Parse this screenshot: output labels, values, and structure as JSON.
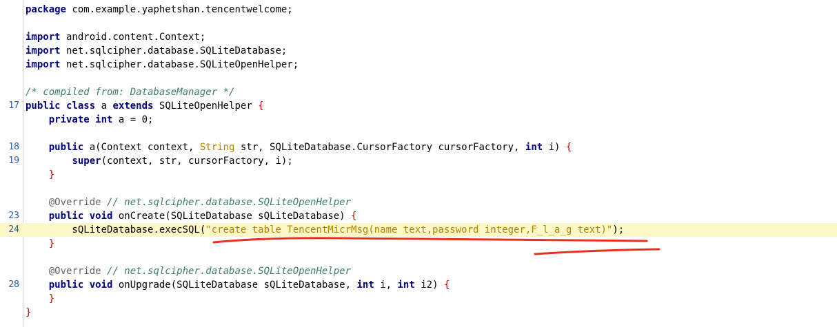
{
  "editor": {
    "colors": {
      "keyword": "#000080",
      "comment": "#3f7f5f",
      "string": "#b58200",
      "brace": "#c80000",
      "highlight": "#fcf8c8",
      "line_number": "#2d5aa8",
      "annotation_mark": "#e8321e"
    },
    "lines": [
      {
        "num": "",
        "tokens": [
          {
            "t": "package",
            "c": "kw"
          },
          {
            "t": " com.example.yaphetshan.tencentwelcome;",
            "c": ""
          }
        ]
      },
      {
        "num": "",
        "tokens": []
      },
      {
        "num": "",
        "tokens": [
          {
            "t": "import",
            "c": "kw"
          },
          {
            "t": " android.content.Context;",
            "c": ""
          }
        ]
      },
      {
        "num": "",
        "tokens": [
          {
            "t": "import",
            "c": "kw"
          },
          {
            "t": " net.sqlcipher.database.SQLiteDatabase;",
            "c": ""
          }
        ]
      },
      {
        "num": "",
        "tokens": [
          {
            "t": "import",
            "c": "kw"
          },
          {
            "t": " net.sqlcipher.database.SQLiteOpenHelper;",
            "c": ""
          }
        ]
      },
      {
        "num": "",
        "tokens": []
      },
      {
        "num": "",
        "tokens": [
          {
            "t": "/* compiled from: DatabaseManager */",
            "c": "cm"
          }
        ]
      },
      {
        "num": "17",
        "tokens": [
          {
            "t": "public",
            "c": "kw"
          },
          {
            "t": " ",
            "c": ""
          },
          {
            "t": "class",
            "c": "kw"
          },
          {
            "t": " a ",
            "c": ""
          },
          {
            "t": "extends",
            "c": "kw"
          },
          {
            "t": " SQLiteOpenHelper ",
            "c": ""
          },
          {
            "t": "{",
            "c": "rd"
          }
        ]
      },
      {
        "num": "",
        "tokens": [
          {
            "t": "    ",
            "c": ""
          },
          {
            "t": "private",
            "c": "kw"
          },
          {
            "t": " ",
            "c": ""
          },
          {
            "t": "int",
            "c": "kw"
          },
          {
            "t": " a = 0;",
            "c": ""
          }
        ]
      },
      {
        "num": "",
        "tokens": []
      },
      {
        "num": "18",
        "tokens": [
          {
            "t": "    ",
            "c": ""
          },
          {
            "t": "public",
            "c": "kw"
          },
          {
            "t": " a(Context context, ",
            "c": ""
          },
          {
            "t": "String",
            "c": "st"
          },
          {
            "t": " str, SQLiteDatabase.CursorFactory cursorFactory, ",
            "c": ""
          },
          {
            "t": "int",
            "c": "kw"
          },
          {
            "t": " i) ",
            "c": ""
          },
          {
            "t": "{",
            "c": "rd"
          }
        ]
      },
      {
        "num": "19",
        "tokens": [
          {
            "t": "        ",
            "c": ""
          },
          {
            "t": "super",
            "c": "kw"
          },
          {
            "t": "(context, str, cursorFactory, i);",
            "c": ""
          }
        ]
      },
      {
        "num": "",
        "tokens": [
          {
            "t": "    ",
            "c": ""
          },
          {
            "t": "}",
            "c": "rd"
          }
        ]
      },
      {
        "num": "",
        "tokens": []
      },
      {
        "num": "",
        "tokens": [
          {
            "t": "    ",
            "c": ""
          },
          {
            "t": "@Override",
            "c": "an"
          },
          {
            "t": " ",
            "c": ""
          },
          {
            "t": "// net.sqlcipher.database.SQLiteOpenHelper",
            "c": "cm"
          }
        ]
      },
      {
        "num": "23",
        "tokens": [
          {
            "t": "    ",
            "c": ""
          },
          {
            "t": "public",
            "c": "kw"
          },
          {
            "t": " ",
            "c": ""
          },
          {
            "t": "void",
            "c": "kw"
          },
          {
            "t": " onCreate(SQLiteDatabase sQLiteDatabase) ",
            "c": ""
          },
          {
            "t": "{",
            "c": "rd"
          }
        ]
      },
      {
        "num": "24",
        "hl": true,
        "tokens": [
          {
            "t": "        sQLiteDatabase.execSQL(",
            "c": ""
          },
          {
            "t": "\"create table TencentMicrMsg(name text,password integer,F_l_a_g text)\"",
            "c": "st"
          },
          {
            "t": ");",
            "c": ""
          }
        ]
      },
      {
        "num": "",
        "tokens": [
          {
            "t": "    ",
            "c": ""
          },
          {
            "t": "}",
            "c": "rd"
          }
        ]
      },
      {
        "num": "",
        "tokens": []
      },
      {
        "num": "",
        "tokens": [
          {
            "t": "    ",
            "c": ""
          },
          {
            "t": "@Override",
            "c": "an"
          },
          {
            "t": " ",
            "c": ""
          },
          {
            "t": "// net.sqlcipher.database.SQLiteOpenHelper",
            "c": "cm"
          }
        ]
      },
      {
        "num": "28",
        "tokens": [
          {
            "t": "    ",
            "c": ""
          },
          {
            "t": "public",
            "c": "kw"
          },
          {
            "t": " ",
            "c": ""
          },
          {
            "t": "void",
            "c": "kw"
          },
          {
            "t": " onUpgrade(SQLiteDatabase sQLiteDatabase, ",
            "c": ""
          },
          {
            "t": "int",
            "c": "kw"
          },
          {
            "t": " i, ",
            "c": ""
          },
          {
            "t": "int",
            "c": "kw"
          },
          {
            "t": " i2) ",
            "c": ""
          },
          {
            "t": "{",
            "c": "rd"
          }
        ]
      },
      {
        "num": "",
        "tokens": [
          {
            "t": "    ",
            "c": ""
          },
          {
            "t": "}",
            "c": "rd"
          }
        ]
      },
      {
        "num": "",
        "tokens": [
          {
            "t": "}",
            "c": "rd"
          }
        ]
      }
    ]
  }
}
